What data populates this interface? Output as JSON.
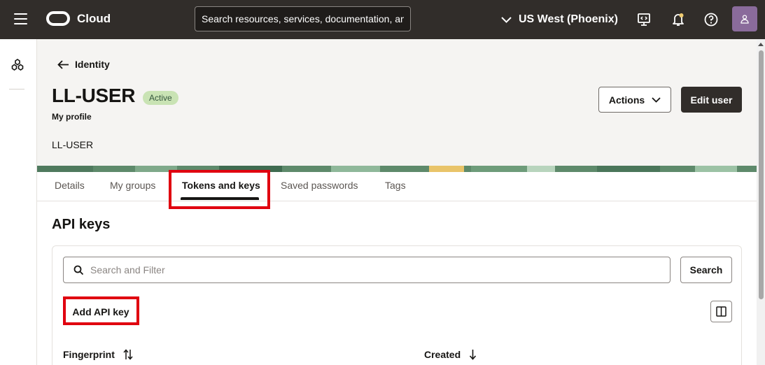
{
  "topbar": {
    "brand": "Cloud",
    "search_placeholder": "Search resources, services, documentation, and Marketplace",
    "region": "US West (Phoenix)",
    "icons": [
      "menu-icon",
      "oracle-logo",
      "chevron-down-icon",
      "developer-tools-icon",
      "notifications-icon",
      "help-icon",
      "profile-icon"
    ]
  },
  "rail": {
    "icons": [
      "identity-icon"
    ]
  },
  "header": {
    "back_label": "Identity",
    "title": "LL-USER",
    "status": "Active",
    "subtitle": "My profile",
    "user_name": "LL-USER",
    "actions_label": "Actions",
    "edit_label": "Edit user"
  },
  "tabs": [
    {
      "label": "Details",
      "active": false
    },
    {
      "label": "My groups",
      "active": false
    },
    {
      "label": "Tokens and keys",
      "active": true
    },
    {
      "label": "Saved passwords",
      "active": false
    },
    {
      "label": "Tags",
      "active": false
    }
  ],
  "api_keys": {
    "title": "API keys",
    "filter_placeholder": "Search and Filter",
    "search_label": "Search",
    "add_label": "Add API key",
    "columns": [
      {
        "label": "Fingerprint",
        "sort": "both"
      },
      {
        "label": "Created",
        "sort": "descending"
      }
    ]
  },
  "colors": {
    "topbar_bg": "#312d2a",
    "header_bg": "#f5f4f2",
    "status_badge_bg": "#c9e3b4",
    "highlight": "#e0000f",
    "primary_button": "#312d2a"
  }
}
